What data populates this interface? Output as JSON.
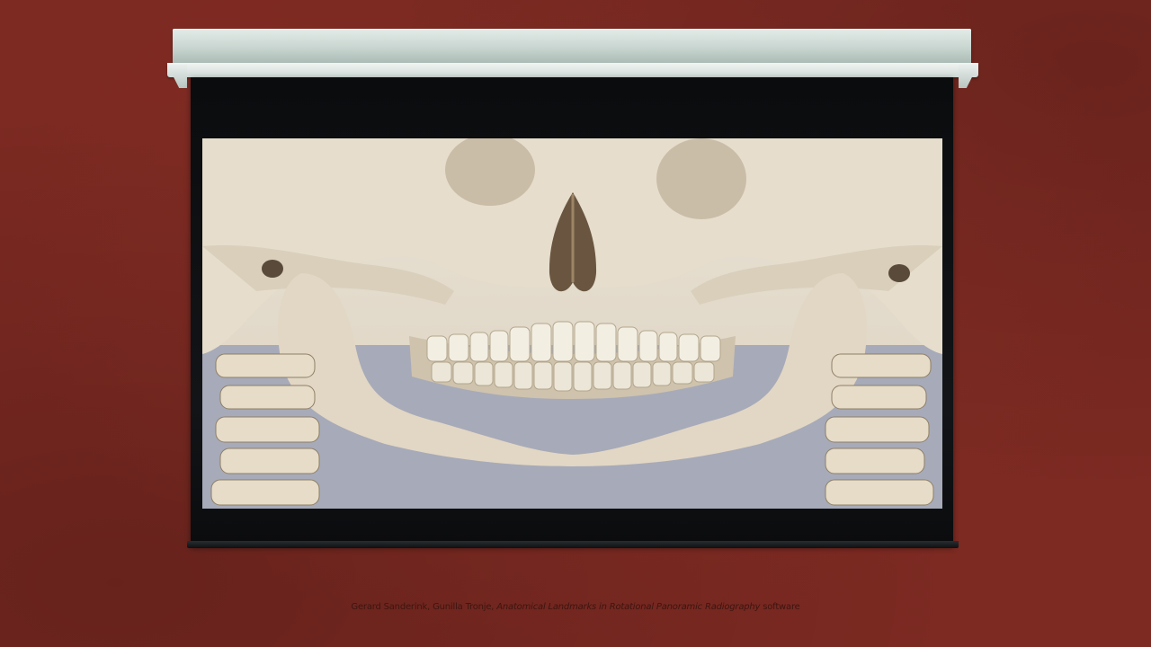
{
  "slide": {
    "background_color": "#7d2a22",
    "media": {
      "type": "video-frame",
      "subject": "anatomy-illustration"
    },
    "caption": {
      "authors": "Gerard Sanderink, Gunilla Tronje, ",
      "title": "Anatomical Landmarks in Rotational Panoramic Radiography",
      "suffix": " software"
    }
  }
}
